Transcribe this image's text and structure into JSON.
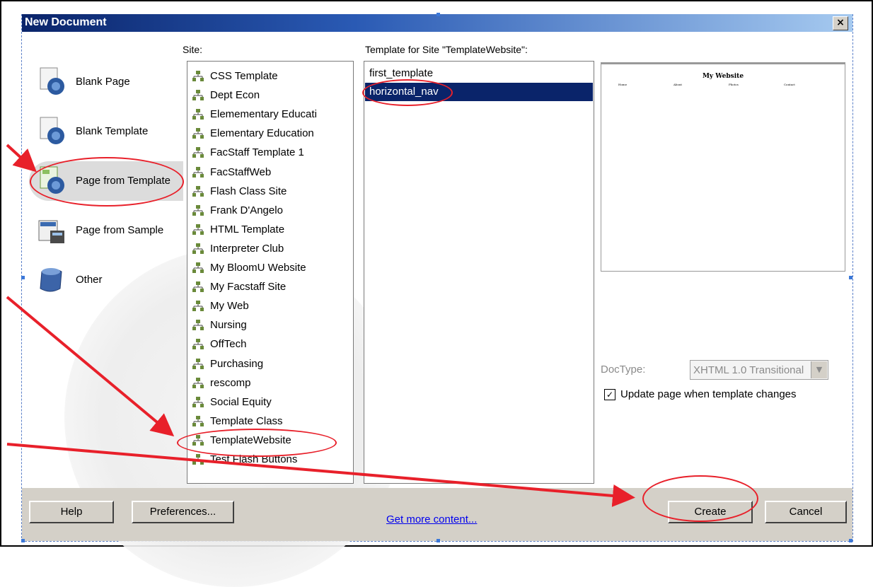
{
  "dialog": {
    "title": "New Document",
    "close_label": "×"
  },
  "left_nav": [
    {
      "label": "Blank Page",
      "icon": "blank-page-icon"
    },
    {
      "label": "Blank Template",
      "icon": "blank-template-icon"
    },
    {
      "label": "Page from Template",
      "icon": "page-from-template-icon",
      "selected": true
    },
    {
      "label": "Page from Sample",
      "icon": "page-from-sample-icon"
    },
    {
      "label": "Other",
      "icon": "other-icon"
    }
  ],
  "site": {
    "header": "Site:",
    "items": [
      "CSS Template",
      "Dept Econ",
      "Elemementary Educati",
      "Elementary Education",
      "FacStaff Template 1",
      "FacStaffWeb",
      "Flash Class Site",
      "Frank D'Angelo",
      "HTML Template",
      "Interpreter Club",
      "My BloomU Website",
      "My Facstaff Site",
      "My Web",
      "Nursing",
      "OffTech",
      "Purchasing",
      "rescomp",
      "Social Equity",
      "Template Class",
      "TemplateWebsite",
      "Test Flash Buttons"
    ],
    "selected": "TemplateWebsite"
  },
  "templates": {
    "header": "Template for Site \"TemplateWebsite\":",
    "items": [
      "first_template",
      "horizontal_nav"
    ],
    "selected": "horizontal_nav"
  },
  "preview": {
    "title": "My Website",
    "nav_items": [
      "Home",
      "About",
      "Photos",
      "Contact"
    ]
  },
  "doctype": {
    "label": "DocType:",
    "value": "XHTML 1.0 Transitional"
  },
  "update_checkbox": {
    "label": "Update page when template changes",
    "checked": true,
    "mark": "✓"
  },
  "buttons": {
    "help": "Help",
    "preferences": "Preferences...",
    "create": "Create",
    "cancel": "Cancel"
  },
  "link": {
    "get_more": "Get more content..."
  },
  "colors": {
    "annotation": "#e8202a",
    "selection": "#0a246a",
    "title_bar": "#0a246a"
  }
}
